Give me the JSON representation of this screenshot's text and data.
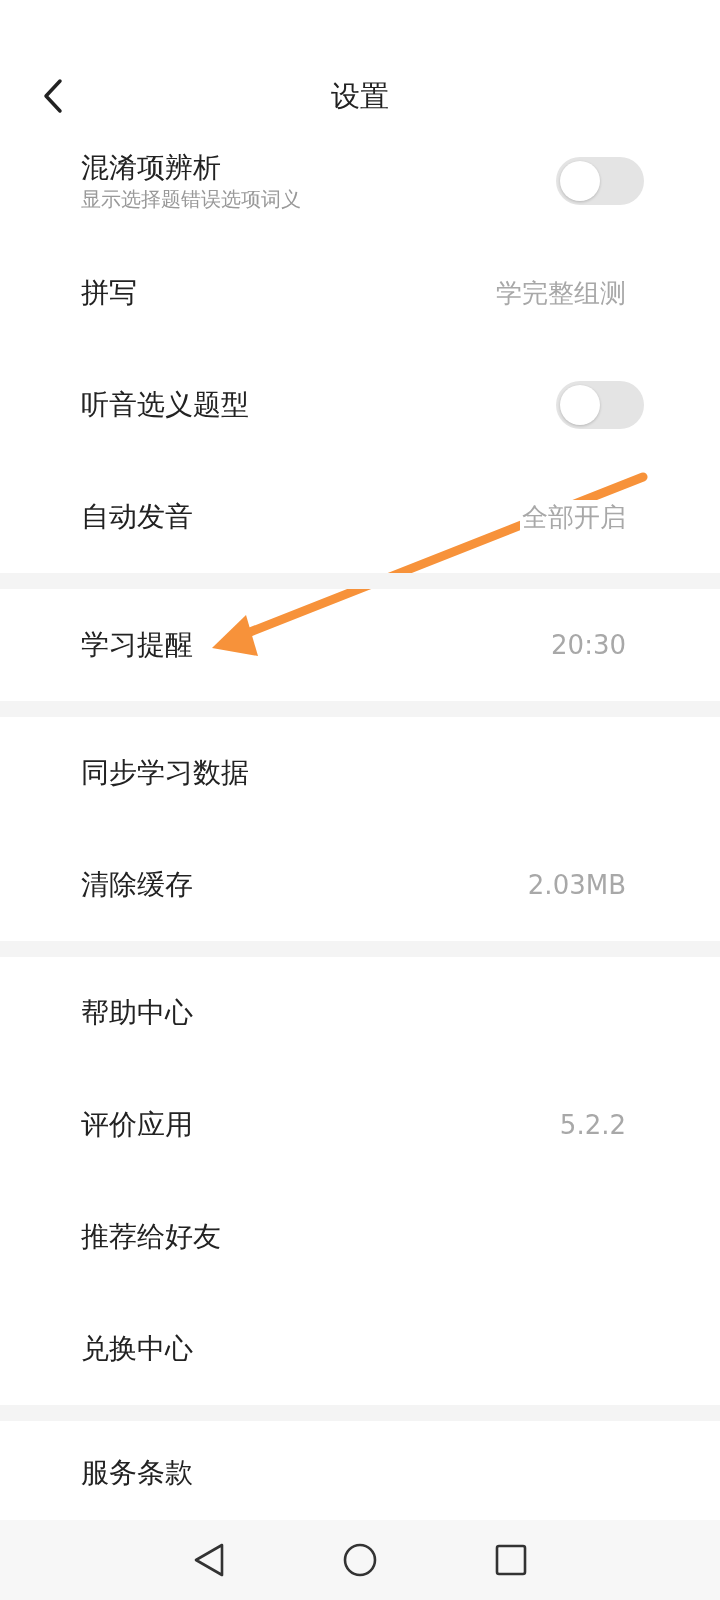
{
  "header": {
    "title": "设置"
  },
  "groups": [
    {
      "rows": [
        {
          "kind": "toggle",
          "label": "混淆项辨析",
          "subtitle": "显示选择题错误选项词义",
          "on": false
        },
        {
          "kind": "value",
          "label": "拼写",
          "value": "学完整组测"
        },
        {
          "kind": "toggle",
          "label": "听音选义题型",
          "on": false
        },
        {
          "kind": "value",
          "label": "自动发音",
          "value": "全部开启"
        }
      ]
    },
    {
      "rows": [
        {
          "kind": "value",
          "label": "学习提醒",
          "value": "20:30"
        }
      ]
    },
    {
      "rows": [
        {
          "kind": "plain",
          "label": "同步学习数据"
        },
        {
          "kind": "value",
          "label": "清除缓存",
          "value": "2.03MB"
        }
      ]
    },
    {
      "rows": [
        {
          "kind": "plain",
          "label": "帮助中心"
        },
        {
          "kind": "value",
          "label": "评价应用",
          "value": "5.2.2"
        },
        {
          "kind": "plain",
          "label": "推荐给好友"
        },
        {
          "kind": "plain",
          "label": "兑换中心"
        }
      ]
    },
    {
      "rows": [
        {
          "kind": "plain",
          "label": "服务条款"
        }
      ]
    }
  ]
}
